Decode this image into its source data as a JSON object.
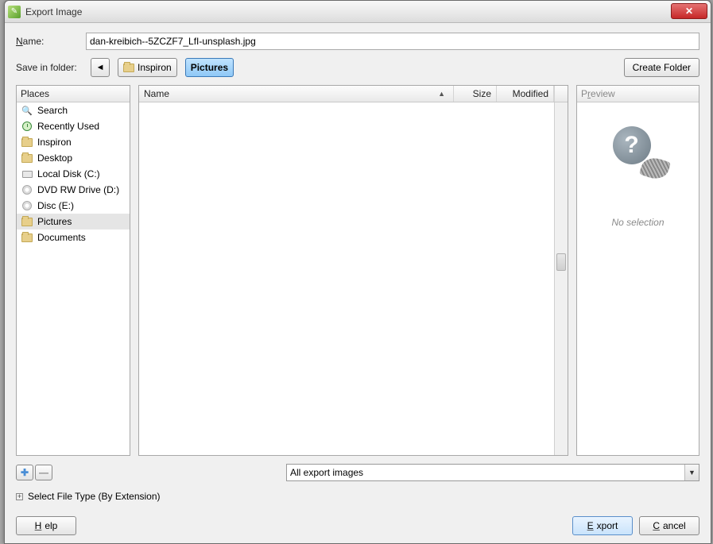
{
  "titlebar": {
    "title": "Export Image"
  },
  "name": {
    "label": "Name:",
    "value": "dan-kreibich--5ZCZF7_LfI-unsplash.jpg"
  },
  "save_in": {
    "label": "Save in folder:",
    "crumbs": [
      {
        "label": "Inspiron",
        "selected": false
      },
      {
        "label": "Pictures",
        "selected": true
      }
    ]
  },
  "create_folder": "Create Folder",
  "places": {
    "header": "Places",
    "items": [
      {
        "label": "Search",
        "icon": "search"
      },
      {
        "label": "Recently Used",
        "icon": "clock"
      },
      {
        "label": "Inspiron",
        "icon": "folder"
      },
      {
        "label": "Desktop",
        "icon": "folder"
      },
      {
        "label": "Local Disk (C:)",
        "icon": "drive"
      },
      {
        "label": "DVD RW Drive (D:)",
        "icon": "disc"
      },
      {
        "label": "Disc (E:)",
        "icon": "disc"
      },
      {
        "label": "Pictures",
        "icon": "folder",
        "selected": true
      },
      {
        "label": "Documents",
        "icon": "folder"
      }
    ]
  },
  "filelist": {
    "columns": {
      "name": "Name",
      "size": "Size",
      "modified": "Modified"
    }
  },
  "preview": {
    "header": "Preview",
    "empty": "No selection"
  },
  "add_btn": "+",
  "remove_btn": "−",
  "filter": {
    "selected": "All export images"
  },
  "filetype": {
    "label": "Select File Type (By Extension)"
  },
  "buttons": {
    "help": "Help",
    "export": "Export",
    "cancel": "Cancel"
  }
}
